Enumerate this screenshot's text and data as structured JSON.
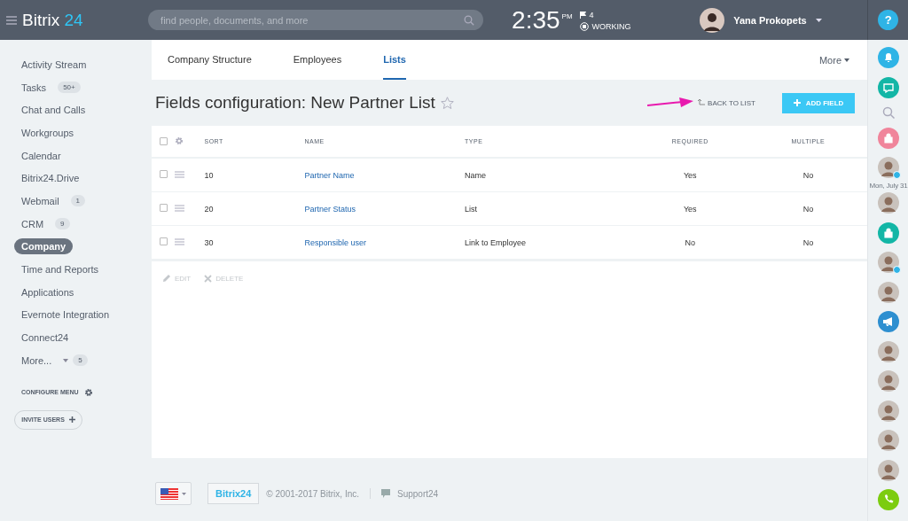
{
  "header": {
    "logo": {
      "name": "Bitrix",
      "number": "24"
    },
    "search": {
      "placeholder": "find people, documents, and more"
    },
    "time": "2:35",
    "meridiem": "PM",
    "flag_count": "4",
    "work_status": "WORKING",
    "user": "Yana Prokopets",
    "help": "?"
  },
  "sidebar": {
    "items": [
      {
        "label": "Activity Stream",
        "selected": false
      },
      {
        "label": "Tasks",
        "counter": "50+",
        "selected": false
      },
      {
        "label": "Chat and Calls",
        "selected": false
      },
      {
        "label": "Workgroups",
        "selected": false
      },
      {
        "label": "Calendar",
        "selected": false
      },
      {
        "label": "Bitrix24.Drive",
        "selected": false
      },
      {
        "label": "Webmail",
        "counter": "1",
        "selected": false
      },
      {
        "label": "CRM",
        "counter": "9",
        "selected": false
      },
      {
        "label": "Company",
        "selected": true
      },
      {
        "label": "Time and Reports",
        "selected": false
      },
      {
        "label": "Applications",
        "selected": false
      },
      {
        "label": "Evernote Integration",
        "selected": false
      },
      {
        "label": "Connect24",
        "selected": false
      },
      {
        "label": "More...",
        "counter": "5",
        "selected": false,
        "dropdown": true
      }
    ],
    "configure": "CONFIGURE MENU",
    "invite": "INVITE USERS"
  },
  "tabs": [
    {
      "label": "Company Structure",
      "selected": false
    },
    {
      "label": "Employees",
      "selected": false
    },
    {
      "label": "Lists",
      "selected": true
    }
  ],
  "more": "More",
  "title": "Fields configuration: New Partner List",
  "back_to_list": "BACK TO LIST",
  "add_field": "ADD FIELD",
  "table": {
    "select_all_checked": false,
    "columns": [
      "SORT",
      "NAME",
      "TYPE",
      "REQUIRED",
      "MULTIPLE"
    ],
    "rows": [
      {
        "checked": false,
        "sort": "10",
        "name": "Partner Name",
        "type": "Name",
        "required": "Yes",
        "multiple": "No"
      },
      {
        "checked": false,
        "sort": "20",
        "name": "Partner Status",
        "type": "List",
        "required": "Yes",
        "multiple": "No"
      },
      {
        "checked": false,
        "sort": "30",
        "name": "Responsible user",
        "type": "Link to Employee",
        "required": "No",
        "multiple": "No"
      }
    ]
  },
  "actions": [
    {
      "label": "EDIT",
      "kind": "edit",
      "disabled": true
    },
    {
      "label": "DELETE",
      "kind": "delete",
      "disabled": true
    }
  ],
  "footer": {
    "logo": "Bitrix24",
    "copyright": "© 2001-2017 Bitrix, Inc.",
    "support": "Support24"
  },
  "right_bar": [
    {
      "kind": "bell",
      "color": "#2fb4e6"
    },
    {
      "kind": "chat",
      "color": "#13b6a6"
    },
    {
      "kind": "search"
    },
    {
      "kind": "lock",
      "color": "#f0859b"
    },
    {
      "kind": "avatar",
      "online": true
    },
    {
      "kind": "date",
      "text": "Mon, July 31"
    },
    {
      "kind": "avatar",
      "online": false
    },
    {
      "kind": "lock",
      "color": "#13b6a6"
    },
    {
      "kind": "avatar",
      "online": true
    },
    {
      "kind": "avatar",
      "online": false
    },
    {
      "kind": "megaphone",
      "color": "#2e8fd0"
    },
    {
      "kind": "avatar",
      "online": false
    },
    {
      "kind": "avatar",
      "online": false
    },
    {
      "kind": "avatar",
      "online": false
    },
    {
      "kind": "avatar",
      "online": false
    },
    {
      "kind": "avatar",
      "online": false
    },
    {
      "kind": "phone",
      "color": "#7ccc10"
    }
  ]
}
